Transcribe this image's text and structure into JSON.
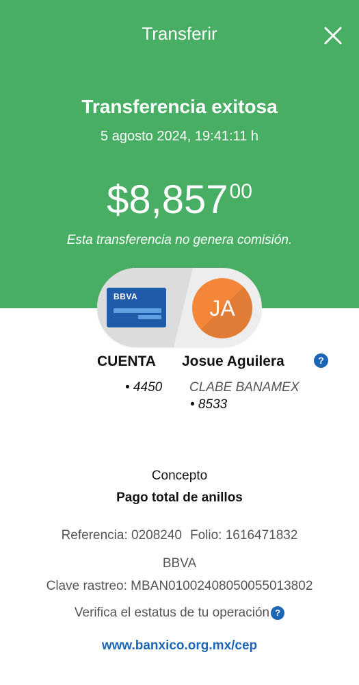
{
  "header": {
    "title": "Transferir",
    "close_icon": "close-icon",
    "status": "Transferencia exitosa",
    "datetime": "5 agosto 2024, 19:41:11 h",
    "amount_int": "$8,857",
    "amount_dec": "00",
    "commission_note": "Esta transferencia no genera comisión."
  },
  "transfer_visual": {
    "card_brand": "BBVA",
    "avatar_initials": "JA"
  },
  "source": {
    "label": "CUENTA",
    "number": "• 4450"
  },
  "destination": {
    "name": "Josue Aguilera",
    "bank": "CLABE BANAMEX",
    "number": "• 8533",
    "help_icon": "?"
  },
  "details": {
    "concept_label": "Concepto",
    "concept_value": "Pago total de anillos",
    "reference": "Referencia: 0208240",
    "folio": "Folio: 1616471832",
    "bank": "BBVA",
    "tracking_key": "Clave rastreo: MBAN01002408050055013802",
    "verify_text": "Verifica el estatus de tu operación",
    "verify_help": "?",
    "link": "www.banxico.org.mx/cep"
  },
  "colors": {
    "header_green": "#48ae64",
    "card_blue": "#1f5ba8",
    "avatar_orange": "#f4863a",
    "link_blue": "#1c66b8"
  }
}
